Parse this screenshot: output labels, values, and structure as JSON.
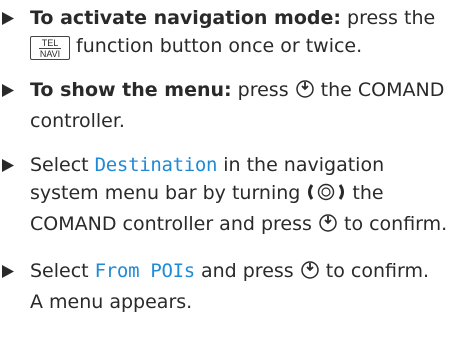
{
  "steps": [
    {
      "bold": "To activate navigation mode:",
      "a": " press the ",
      "key_top": "TEL",
      "key_bottom": "NAVI",
      "b": " function button once or twice."
    },
    {
      "bold": "To show the menu:",
      "a": " press ",
      "b": " the COMAND controller."
    },
    {
      "a": "Select ",
      "ui": "Destination",
      "b": " in the navigation system menu bar by turning ",
      "c": " the COMAND controller and press ",
      "d": " to confirm."
    },
    {
      "a": "Select ",
      "ui": "From POIs",
      "b": " and press ",
      "c": " to confirm.",
      "d": "A menu appears."
    }
  ],
  "icons": {
    "bullet": "right-triangle-bullet-icon",
    "press": "controller-press-icon",
    "turn": "controller-turn-icon",
    "function_key": "tel-navi-key-icon"
  },
  "colors": {
    "ui_text": "#1f8bd6",
    "body_text": "#2a2a2a"
  }
}
